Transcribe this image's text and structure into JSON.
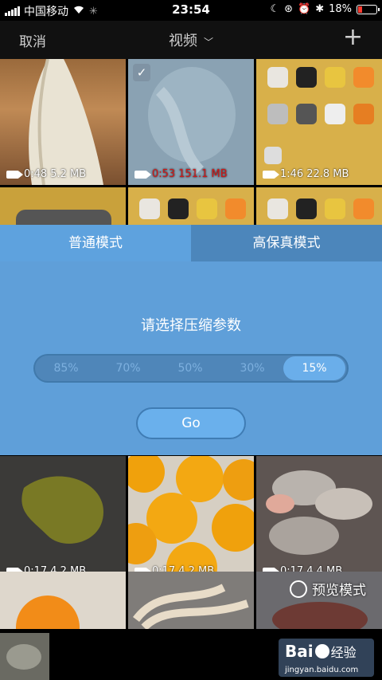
{
  "status_bar": {
    "carrier": "中国移动",
    "time": "23:54",
    "battery": "18%"
  },
  "nav": {
    "cancel": "取消",
    "title": "视频",
    "add": "+"
  },
  "videos": [
    {
      "duration": "0:48",
      "size": "5.2 MB",
      "selected": false
    },
    {
      "duration": "0:53",
      "size": "151.1 MB",
      "selected": true
    },
    {
      "duration": "1:46",
      "size": "22.8 MB",
      "selected": false
    },
    {
      "duration": "",
      "size": "",
      "selected": false
    },
    {
      "duration": "",
      "size": "",
      "selected": false
    },
    {
      "duration": "",
      "size": "",
      "selected": false
    },
    {
      "duration": "0:17",
      "size": "4.2 MB",
      "selected": false
    },
    {
      "duration": "0:17",
      "size": "4.2 MB",
      "selected": false
    },
    {
      "duration": "0:17",
      "size": "4.4 MB",
      "selected": false
    }
  ],
  "compress_dialog": {
    "tabs": [
      "普通模式",
      "高保真模式"
    ],
    "active_tab": 0,
    "prompt": "请选择压缩参数",
    "options": [
      "85%",
      "70%",
      "50%",
      "30%",
      "15%"
    ],
    "selected_option": "15%",
    "go_label": "Go"
  },
  "preview_mode_label": "预览模式",
  "watermark": {
    "brand_left": "Bai",
    "brand_right": "经验",
    "url": "jingyan.baidu.com"
  },
  "colors": {
    "dialog_bg": "#5f9fd9",
    "tab_inactive": "#4c86bb",
    "selected_size_text": "#d01818"
  }
}
